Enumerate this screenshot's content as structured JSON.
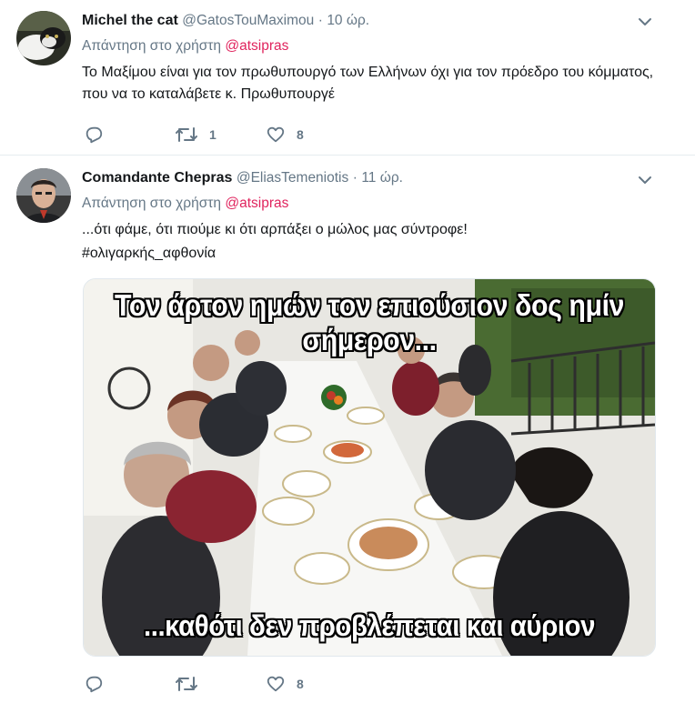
{
  "tweets": [
    {
      "name": "Michel the cat",
      "handle": "@GatosTouMaximou",
      "dot": "·",
      "time": "10 ώρ.",
      "reply_prefix": "Απάντηση στο χρήστη",
      "reply_mention": "@atsipras",
      "text": "Το Μαξίμου είναι για τον πρωθυπουργό των Ελλήνων όχι για τον πρόεδρο του κόμματος, που να το καταλάβετε κ. Πρωθυπουργέ",
      "retweets": "1",
      "likes": "8"
    },
    {
      "name": "Comandante Chepras",
      "handle": "@EliasTemeniotis",
      "dot": "·",
      "time": "11 ώρ.",
      "reply_prefix": "Απάντηση στο χρήστη",
      "reply_mention": "@atsipras",
      "text": "...ότι φάμε, ότι πιούμε κι ότι αρπάξει ο μώλος μας σύντροφε!",
      "hashtag": "#ολιγαρκής_αφθονία",
      "media": {
        "caption_top": "Τον άρτον ημών τον επιούσιον δος ημίν σήμερον...",
        "caption_bottom": "...καθότι δεν προβλέπεται και αύριον"
      },
      "retweets": "",
      "likes": "8"
    }
  ],
  "icons": {
    "reply": "reply-icon",
    "retweet": "retweet-icon",
    "like": "heart-icon",
    "menu": "chevron-down-icon"
  },
  "colors": {
    "accent": "#e0245e",
    "muted": "#657786",
    "text": "#14171a"
  }
}
